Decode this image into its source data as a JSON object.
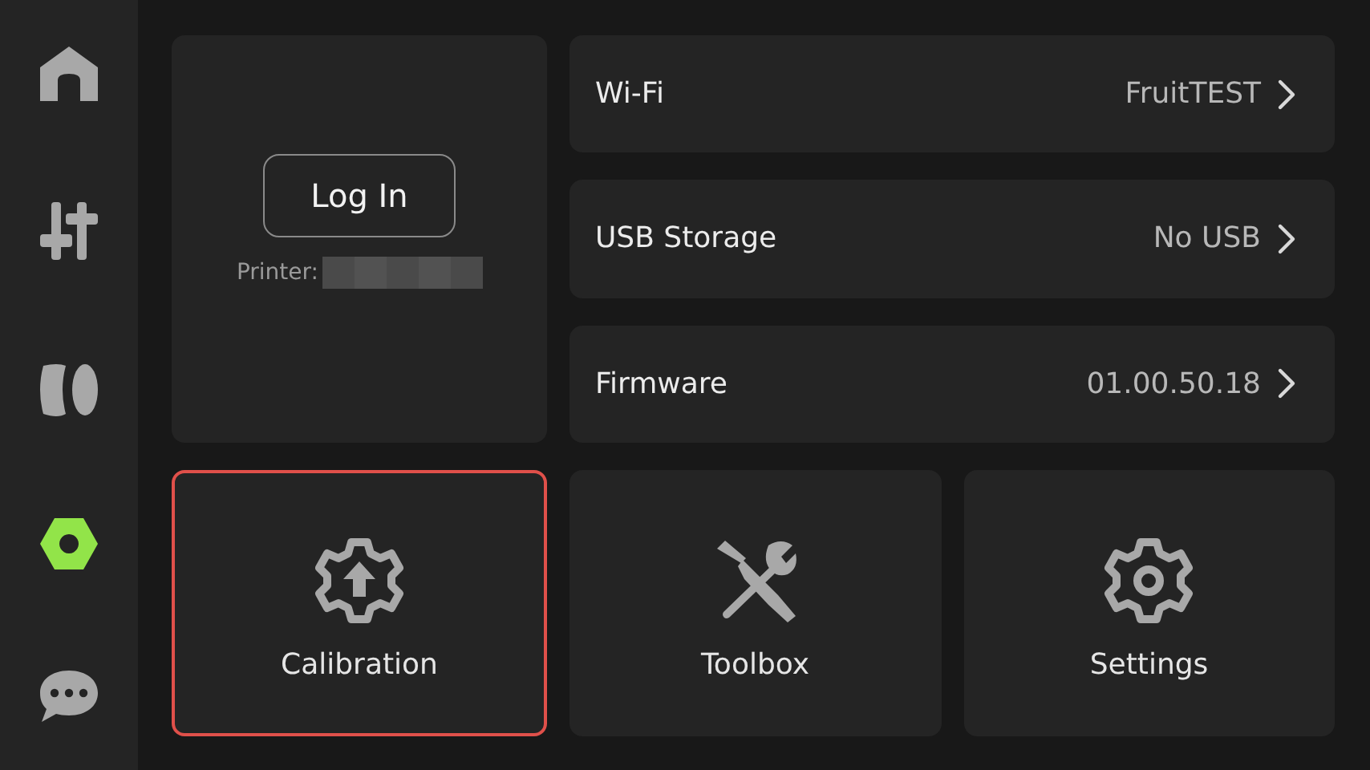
{
  "sidebar": {
    "items": [
      {
        "selected": false
      },
      {
        "selected": false
      },
      {
        "selected": false
      },
      {
        "selected": true
      },
      {
        "selected": false
      }
    ]
  },
  "account": {
    "button": "Log In",
    "printer_label": "Printer:"
  },
  "rows": [
    {
      "label": "Wi-Fi",
      "value": "FruitTEST"
    },
    {
      "label": "USB Storage",
      "value": "No USB"
    },
    {
      "label": "Firmware",
      "value": "01.00.50.18"
    }
  ],
  "tiles": [
    {
      "label": "Calibration",
      "selected": true
    },
    {
      "label": "Toolbox",
      "selected": false
    },
    {
      "label": "Settings",
      "selected": false
    }
  ]
}
